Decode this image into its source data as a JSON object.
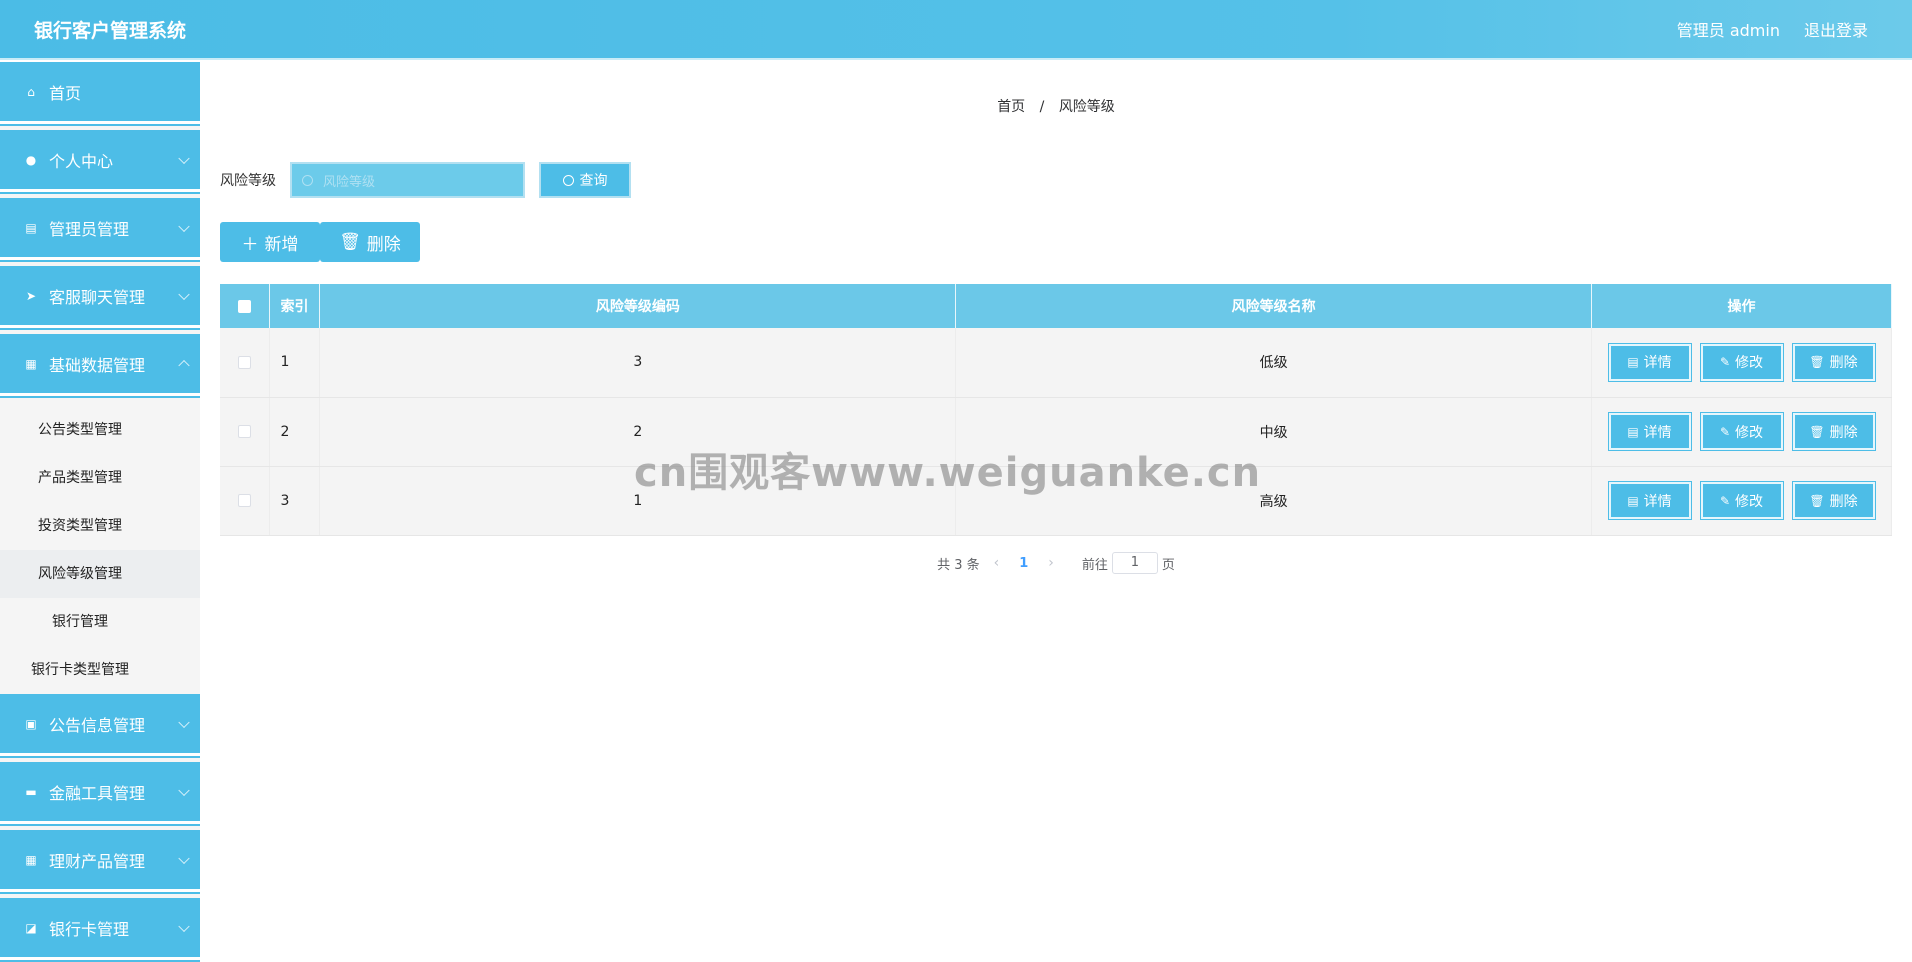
{
  "header": {
    "title": "银行客户管理系统",
    "user": "管理员 admin",
    "logout": "退出登录"
  },
  "sidebar": {
    "items": [
      {
        "label": "首页",
        "icon": "home-icon"
      },
      {
        "label": "个人中心",
        "icon": "user-icon"
      },
      {
        "label": "管理员管理",
        "icon": "chart-icon"
      },
      {
        "label": "客服聊天管理",
        "icon": "send-icon"
      },
      {
        "label": "基础数据管理",
        "icon": "grid-icon"
      },
      {
        "label": "公告信息管理",
        "icon": "clipboard-icon"
      },
      {
        "label": "金融工具管理",
        "icon": "card-icon"
      },
      {
        "label": "理财产品管理",
        "icon": "grid-icon"
      },
      {
        "label": "银行卡管理",
        "icon": "ticket-icon"
      }
    ],
    "submenu": [
      "公告类型管理",
      "产品类型管理",
      "投资类型管理",
      "风险等级管理",
      "银行管理",
      "银行卡类型管理"
    ]
  },
  "breadcrumb": {
    "home": "首页",
    "sep": "/",
    "current": "风险等级"
  },
  "search": {
    "label": "风险等级",
    "placeholder": "风险等级",
    "button": "查询"
  },
  "actions": {
    "add": "新增",
    "delete": "删除"
  },
  "table": {
    "headers": {
      "index": "索引",
      "code": "风险等级编码",
      "name": "风险等级名称",
      "ops": "操作"
    },
    "rows": [
      {
        "index": "1",
        "code": "3",
        "name": "低级"
      },
      {
        "index": "2",
        "code": "2",
        "name": "中级"
      },
      {
        "index": "3",
        "code": "1",
        "name": "高级"
      }
    ],
    "op_labels": {
      "detail": "详情",
      "edit": "修改",
      "delete": "删除"
    }
  },
  "pagination": {
    "total": "共 3 条",
    "current_page": "1",
    "goto_prefix": "前往",
    "goto_value": "1",
    "goto_suffix": "页"
  },
  "watermark": "cn围观客www.weiguanke.cn",
  "colors": {
    "primary": "#4dbde7",
    "header_table": "#6bc8e8",
    "page_active": "#409eff"
  }
}
